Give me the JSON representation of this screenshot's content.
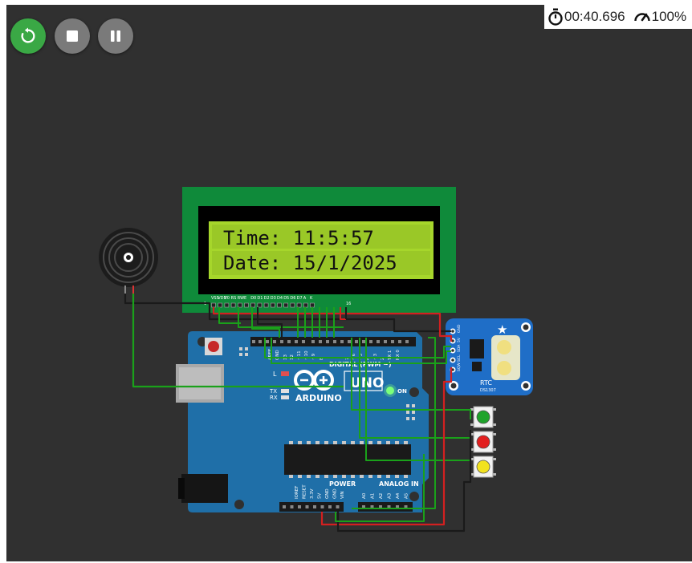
{
  "toolbar": {
    "restart_icon": "restart-icon",
    "stop_icon": "stop-icon",
    "pause_icon": "pause-icon",
    "timer": "00:40.696",
    "speed": "100%",
    "timer_icon": "stopwatch-icon",
    "speed_icon": "speedometer-icon",
    "restart_color": "#3aa845",
    "button_color": "#7a7a7a"
  },
  "lcd": {
    "line1": "Time: 11:5:57",
    "line2": "Date: 15/1/2025",
    "pins": [
      "VSS",
      "VDD",
      "V0",
      "RS",
      "RW",
      "E",
      "D0",
      "D1",
      "D2",
      "D3",
      "D4",
      "D5",
      "D6",
      "D7",
      "A",
      "K"
    ],
    "pin_first": "1",
    "pin_last": "16",
    "board_color": "#0f8a3a",
    "screen_color": "#a6d62b"
  },
  "rtc": {
    "label": "RTC",
    "model": "DS1307",
    "pins": [
      "GND",
      "5V",
      "SDA",
      "SCL",
      "SQW"
    ]
  },
  "arduino": {
    "logo_text": "ARDUINO",
    "model": "UNO",
    "digital_label": "DIGITAL (PWM ~)",
    "power_label": "POWER",
    "analog_label": "ANALOG IN",
    "on_label": "ON",
    "tx_label": "TX",
    "rx_label": "RX",
    "l_label": "L",
    "top_pins": [
      "AREF",
      "GND",
      "13",
      "12",
      "~11",
      "~10",
      "~9",
      "8",
      "7",
      "~6",
      "~5",
      "4",
      "~3",
      "2",
      "TX 1",
      "RX 0"
    ],
    "power_pins": [
      "IOREF",
      "RESET",
      "3.3V",
      "5V",
      "GND",
      "GND",
      "VIN"
    ],
    "analog_pins": [
      "A0",
      "A1",
      "A2",
      "A3",
      "A4",
      "A5"
    ],
    "board_color": "#1f6fa8"
  },
  "buttons": [
    {
      "name": "green",
      "color": "#1fa32b"
    },
    {
      "name": "red",
      "color": "#e21f1f"
    },
    {
      "name": "yellow",
      "color": "#f2e21f"
    }
  ]
}
